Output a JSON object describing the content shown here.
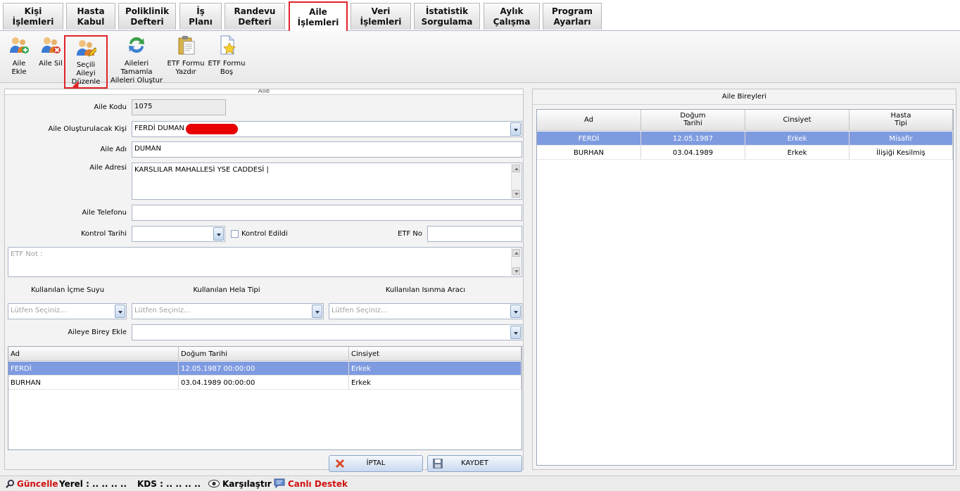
{
  "tabs": [
    {
      "l1": "Kişi",
      "l2": "İşlemleri"
    },
    {
      "l1": "Hasta",
      "l2": "Kabul"
    },
    {
      "l1": "Poliklinik",
      "l2": "Defteri"
    },
    {
      "l1": "İş",
      "l2": "Planı"
    },
    {
      "l1": "Randevu",
      "l2": "Defteri"
    },
    {
      "l1": "Aile",
      "l2": "İşlemleri"
    },
    {
      "l1": "Veri",
      "l2": "İşlemleri"
    },
    {
      "l1": "İstatistik",
      "l2": "Sorgulama"
    },
    {
      "l1": "Aylık",
      "l2": "Çalışma"
    },
    {
      "l1": "Program",
      "l2": "Ayarları"
    }
  ],
  "toolbar": [
    {
      "l1": "Aile Ekle",
      "l2": "",
      "icon": "family-add-icon"
    },
    {
      "l1": "Aile Sil",
      "l2": "",
      "icon": "family-delete-icon"
    },
    {
      "l1": "Seçili Aileyi",
      "l2": "Düzenle",
      "icon": "family-edit-icon"
    },
    {
      "l1": "Aileleri Tamamla",
      "l2": "Aileleri Oluştur",
      "icon": "refresh-arrows-icon"
    },
    {
      "l1": "ETF Formu",
      "l2": "Yazdır",
      "icon": "clipboard-print-icon"
    },
    {
      "l1": "ETF Formu",
      "l2": "Boş",
      "icon": "document-star-icon"
    }
  ],
  "left_panel": {
    "title": "Aile"
  },
  "form": {
    "aile_kodu_label": "Aile Kodu",
    "aile_kodu": "1075",
    "olusturulacak_label": "Aile Oluşturulacak Kişi",
    "olusturulacak": "FERDİ DUMAN (",
    "aile_adi_label": "Aile Adı",
    "aile_adi": "DUMAN",
    "adres_label": "Aile Adresi",
    "adres": "KARSLILAR MAHALLESİ YSE CADDESİ |",
    "telefon_label": "Aile Telefonu",
    "telefon": "",
    "kontrol_label": "Kontrol Tarihi",
    "kontrol_edildi": "Kontrol Edildi",
    "etf_no_label": "ETF No",
    "etf_no": "",
    "etf_not_placeholder": "ETF Not :",
    "icme_label": "Kullanılan İçme Suyu",
    "hela_label": "Kullanılan Hela Tipi",
    "isinma_label": "Kullanılan Isınma Aracı",
    "secim_placeholder": "Lütfen Seçiniz...",
    "birey_ekle_label": "Aileye Birey Ekle"
  },
  "member_grid": {
    "headers": [
      "Ad",
      "Doğum Tarihi",
      "Cinsiyet"
    ],
    "rows": [
      [
        "FERDİ",
        "12.05.1987 00:00:00",
        "Erkek"
      ],
      [
        "BURHAN",
        "03.04.1989 00:00:00",
        "Erkek"
      ]
    ]
  },
  "buttons": {
    "cancel": "İPTAL",
    "save": "KAYDET"
  },
  "right_panel": {
    "title": "Aile Bireyleri",
    "headers": [
      {
        "l1": "Ad",
        "l2": ""
      },
      {
        "l1": "Doğum",
        "l2": "Tarihi"
      },
      {
        "l1": "Cinsiyet",
        "l2": ""
      },
      {
        "l1": "Hasta",
        "l2": "Tipi"
      }
    ],
    "rows": [
      [
        "FERDİ",
        "12.05.1987",
        "Erkek",
        "Misafir"
      ],
      [
        "BURHAN",
        "03.04.1989",
        "Erkek",
        "İlişiği Kesilmiş"
      ]
    ]
  },
  "status": {
    "guncelle": "Güncelle",
    "yerel": "Yerel : .. .. .. ..",
    "kds": "KDS : .. .. .. ..",
    "karsilastir": "Karşılaştır",
    "canli": "Canlı Destek"
  },
  "colors": {
    "accent": "#e0232a",
    "selection": "#7f9be0",
    "link_red": "#d01010"
  }
}
